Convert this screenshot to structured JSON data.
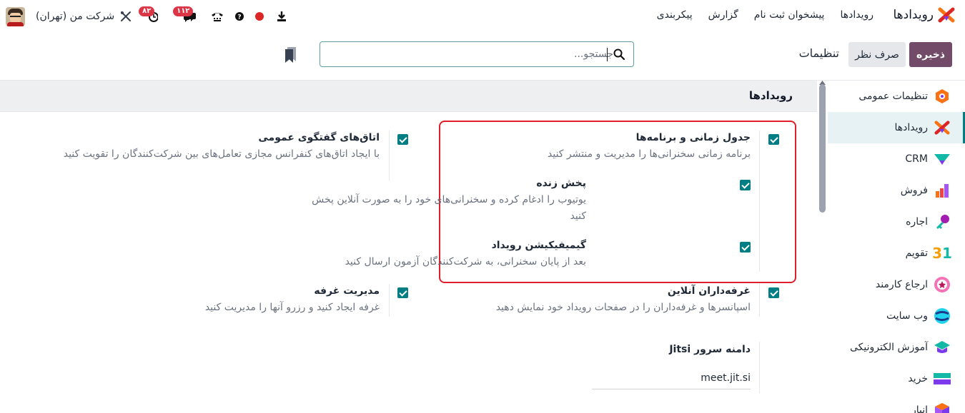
{
  "topbar": {
    "app_title": "رویدادها",
    "menu": [
      "رویدادها",
      "پیشخوان ثبت نام",
      "گزارش",
      "پیکربندی"
    ],
    "company": "شرکت من (تهران)",
    "badges": {
      "activities": "۸۲",
      "messages": "۱۱۲"
    }
  },
  "control": {
    "save_label": "ذخیره",
    "discard_label": "صرف نظر",
    "page_title": "تنظیمات",
    "search_placeholder": "جستجو..."
  },
  "section": {
    "title": "رویدادها"
  },
  "settings": {
    "schedule": {
      "title": "جدول زمانی و برنامه‌ها",
      "desc": "برنامه زمانی سخنرانی‌ها را مدیریت و منتشر کنید"
    },
    "live": {
      "title": "پخش زنده",
      "desc": "یوتیوب را ادغام کرده و سخنرانی‌های خود را به صورت آنلاین پخش کنید"
    },
    "gamification": {
      "title": "گیمیفیکیشن رویداد",
      "desc": "بعد از پایان سخنرانی، به شرکت‌کنندگان آزمون ارسال کنید"
    },
    "rooms": {
      "title": "اتاق‌های گفتگوی عمومی",
      "desc": "با ایجاد اتاق‌های کنفرانس مجازی تعامل‌های بین شرکت‌کنندگان را تقویت کنید"
    },
    "exhibitors": {
      "title": "غرفه‌داران آنلاین",
      "desc": "اسپانسرها و غرفه‌داران را در صفحات رویداد خود نمایش دهید"
    },
    "booths": {
      "title": "مدیریت غرفه",
      "desc": "غرفه ایجاد کنید و رزرو آنها را مدیریت کنید"
    },
    "jitsi": {
      "label": "دامنه سرور Jitsi",
      "value": "meet.jit.si"
    }
  },
  "sidebar": {
    "items": [
      {
        "label": "تنظیمات عمومی",
        "icon": "general-settings-icon"
      },
      {
        "label": "رویدادها",
        "icon": "events-icon"
      },
      {
        "label": "CRM",
        "icon": "crm-icon"
      },
      {
        "label": "فروش",
        "icon": "sales-icon"
      },
      {
        "label": "اجاره",
        "icon": "rental-icon"
      },
      {
        "label": "تقویم",
        "icon": "calendar-icon"
      },
      {
        "label": "ارجاع کارمند",
        "icon": "referral-icon"
      },
      {
        "label": "وب سایت",
        "icon": "website-icon"
      },
      {
        "label": "آموزش الکترونیکی",
        "icon": "elearning-icon"
      },
      {
        "label": "خرید",
        "icon": "purchase-icon"
      },
      {
        "label": "انبار",
        "icon": "inventory-icon"
      }
    ],
    "calendar_number": "31"
  },
  "colors": {
    "brand": "#714b67",
    "accent": "#017e84",
    "highlight": "#e11d2c"
  }
}
